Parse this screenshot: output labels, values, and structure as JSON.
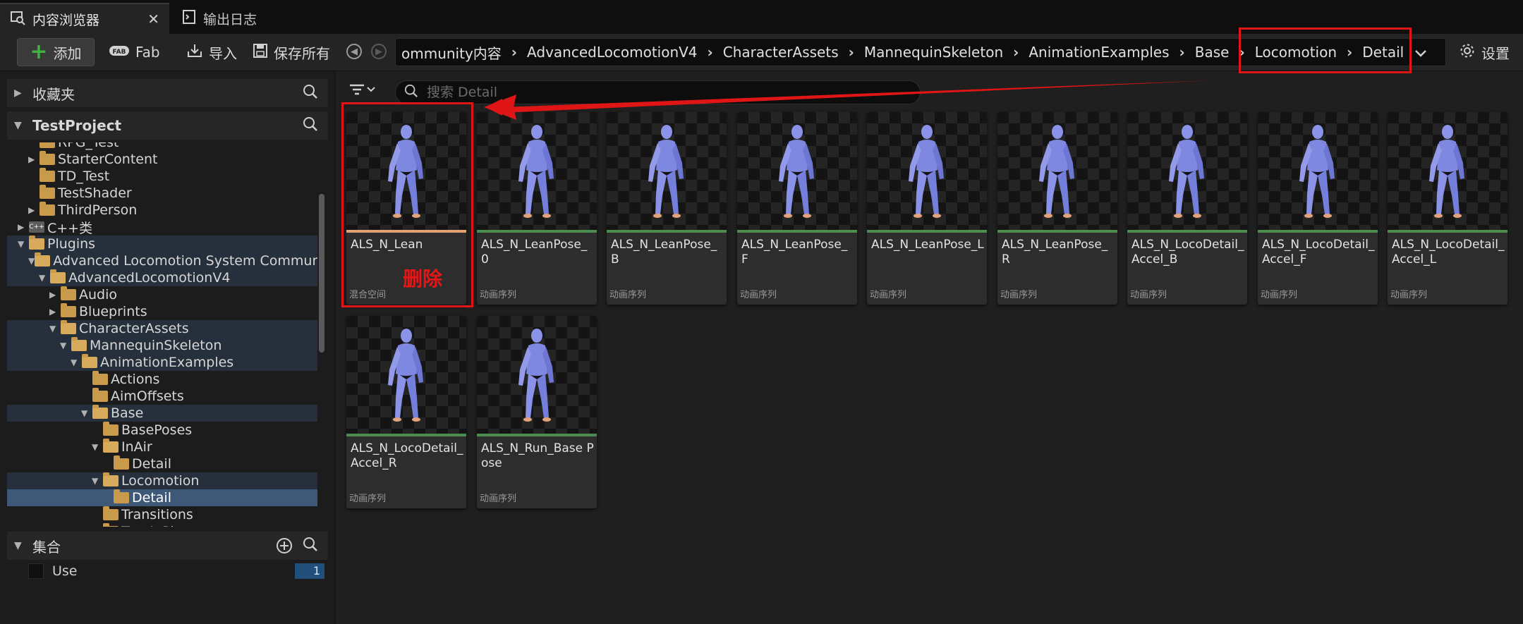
{
  "tabs": [
    {
      "label": "内容浏览器",
      "active": true,
      "icon": "content-browser-icon"
    },
    {
      "label": "输出日志",
      "active": false,
      "icon": "output-log-icon"
    }
  ],
  "toolbar": {
    "add_label": "添加",
    "fab_label": "Fab",
    "import_label": "导入",
    "save_all_label": "保存所有",
    "settings_label": "设置"
  },
  "breadcrumb": [
    "ommunity内容",
    "AdvancedLocomotionV4",
    "CharacterAssets",
    "MannequinSkeleton",
    "AnimationExamples",
    "Base",
    "Locomotion",
    "Detail"
  ],
  "sidebar": {
    "favorites_label": "收藏夹",
    "project_label": "TestProject",
    "tree": [
      {
        "label": "RPG_Test",
        "depth": 2,
        "type": "folder",
        "arrow": "none"
      },
      {
        "label": "StarterContent",
        "depth": 2,
        "type": "folder",
        "arrow": "right"
      },
      {
        "label": "TD_Test",
        "depth": 2,
        "type": "folder",
        "arrow": "none"
      },
      {
        "label": "TestShader",
        "depth": 2,
        "type": "folder",
        "arrow": "none"
      },
      {
        "label": "ThirdPerson",
        "depth": 2,
        "type": "folder",
        "arrow": "right"
      },
      {
        "label": "C++类",
        "depth": 1,
        "type": "cpp",
        "arrow": "right"
      },
      {
        "label": "Plugins",
        "depth": 1,
        "type": "folder-open",
        "arrow": "down",
        "highlight": true
      },
      {
        "label": "Advanced Locomotion System Community",
        "depth": 2,
        "type": "folder-open",
        "arrow": "down",
        "highlight": true
      },
      {
        "label": "AdvancedLocomotionV4",
        "depth": 3,
        "type": "folder-open",
        "arrow": "down",
        "highlight": true
      },
      {
        "label": "Audio",
        "depth": 4,
        "type": "folder",
        "arrow": "right"
      },
      {
        "label": "Blueprints",
        "depth": 4,
        "type": "folder",
        "arrow": "right"
      },
      {
        "label": "CharacterAssets",
        "depth": 4,
        "type": "folder-open",
        "arrow": "down",
        "highlight": true
      },
      {
        "label": "MannequinSkeleton",
        "depth": 5,
        "type": "folder-open",
        "arrow": "down",
        "highlight": true
      },
      {
        "label": "AnimationExamples",
        "depth": 6,
        "type": "folder-open",
        "arrow": "down",
        "highlight": true
      },
      {
        "label": "Actions",
        "depth": 7,
        "type": "folder",
        "arrow": "none"
      },
      {
        "label": "AimOffsets",
        "depth": 7,
        "type": "folder",
        "arrow": "none"
      },
      {
        "label": "Base",
        "depth": 7,
        "type": "folder-open",
        "arrow": "down",
        "highlight": true
      },
      {
        "label": "BasePoses",
        "depth": 8,
        "type": "folder",
        "arrow": "none"
      },
      {
        "label": "InAir",
        "depth": 8,
        "type": "folder-open",
        "arrow": "down"
      },
      {
        "label": "Detail",
        "depth": 9,
        "type": "folder",
        "arrow": "none"
      },
      {
        "label": "Locomotion",
        "depth": 8,
        "type": "folder-open",
        "arrow": "down",
        "highlight": true
      },
      {
        "label": "Detail",
        "depth": 9,
        "type": "folder",
        "arrow": "none",
        "selected": true
      },
      {
        "label": "Transitions",
        "depth": 8,
        "type": "folder",
        "arrow": "none"
      },
      {
        "label": "TurnInPlace",
        "depth": 8,
        "type": "folder",
        "arrow": "none"
      }
    ],
    "collections_label": "集合",
    "collection_item": {
      "label": "Use",
      "count": "1"
    }
  },
  "search": {
    "placeholder": "搜索 Detail"
  },
  "assets": [
    {
      "name": "ALS_N_Lean",
      "type": "混合空间",
      "kind": "blend"
    },
    {
      "name": "ALS_N_LeanPose_0",
      "type": "动画序列",
      "kind": "anim"
    },
    {
      "name": "ALS_N_LeanPose_B",
      "type": "动画序列",
      "kind": "anim"
    },
    {
      "name": "ALS_N_LeanPose_F",
      "type": "动画序列",
      "kind": "anim"
    },
    {
      "name": "ALS_N_LeanPose_L",
      "type": "动画序列",
      "kind": "anim"
    },
    {
      "name": "ALS_N_LeanPose_R",
      "type": "动画序列",
      "kind": "anim"
    },
    {
      "name": "ALS_N_LocoDetail_Accel_B",
      "type": "动画序列",
      "kind": "anim"
    },
    {
      "name": "ALS_N_LocoDetail_Accel_F",
      "type": "动画序列",
      "kind": "anim"
    },
    {
      "name": "ALS_N_LocoDetail_Accel_L",
      "type": "动画序列",
      "kind": "anim"
    },
    {
      "name": "ALS_N_LocoDetail_Accel_R",
      "type": "动画序列",
      "kind": "anim"
    },
    {
      "name": "ALS_N_Run_Base Pose",
      "type": "动画序列",
      "kind": "anim"
    }
  ],
  "annotation": {
    "label": "删除",
    "color": "#e01515"
  },
  "colors": {
    "accent_select": "#3e5878",
    "anim_bar": "#4d8c4f",
    "blend_bar": "#e0a070",
    "folder": "#c99a4b"
  }
}
